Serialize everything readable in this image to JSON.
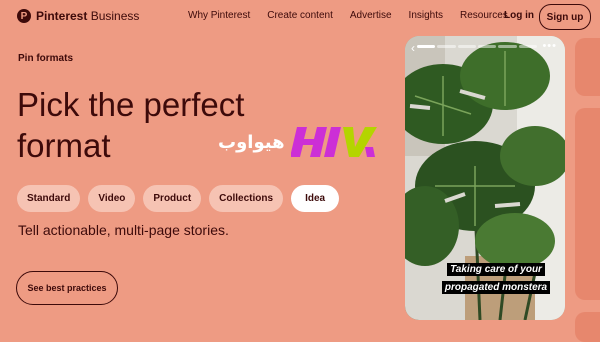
{
  "nav": {
    "logo_icon": "pinterest-p-icon",
    "logo_brand": "Pinterest",
    "logo_suffix": " Business",
    "links": [
      "Why Pinterest",
      "Create content",
      "Advertise",
      "Insights",
      "Resources"
    ],
    "login": "Log in",
    "signup": "Sign up"
  },
  "hero": {
    "eyebrow": "Pin formats",
    "headline": "Pick the perfect format",
    "chips": [
      {
        "label": "Standard",
        "active": false
      },
      {
        "label": "Video",
        "active": false
      },
      {
        "label": "Product",
        "active": false
      },
      {
        "label": "Collections",
        "active": false
      },
      {
        "label": "Idea",
        "active": true
      }
    ],
    "tagline": "Tell actionable, multi-page stories.",
    "cta": "See best practices"
  },
  "watermark": {
    "arabic": "هیواوب",
    "logo": "HIVA"
  },
  "preview": {
    "caption_line1": "Taking care of your",
    "caption_line2": "propagated monstera",
    "back_icon": "chevron-left-icon",
    "more_icon": "more-dots-icon",
    "story_pages": 6,
    "current_page": 1
  },
  "colors": {
    "background": "#ee9b83",
    "text": "#3d0a0a",
    "chip": "#f6c3b3",
    "chip_active": "#ffffff"
  }
}
